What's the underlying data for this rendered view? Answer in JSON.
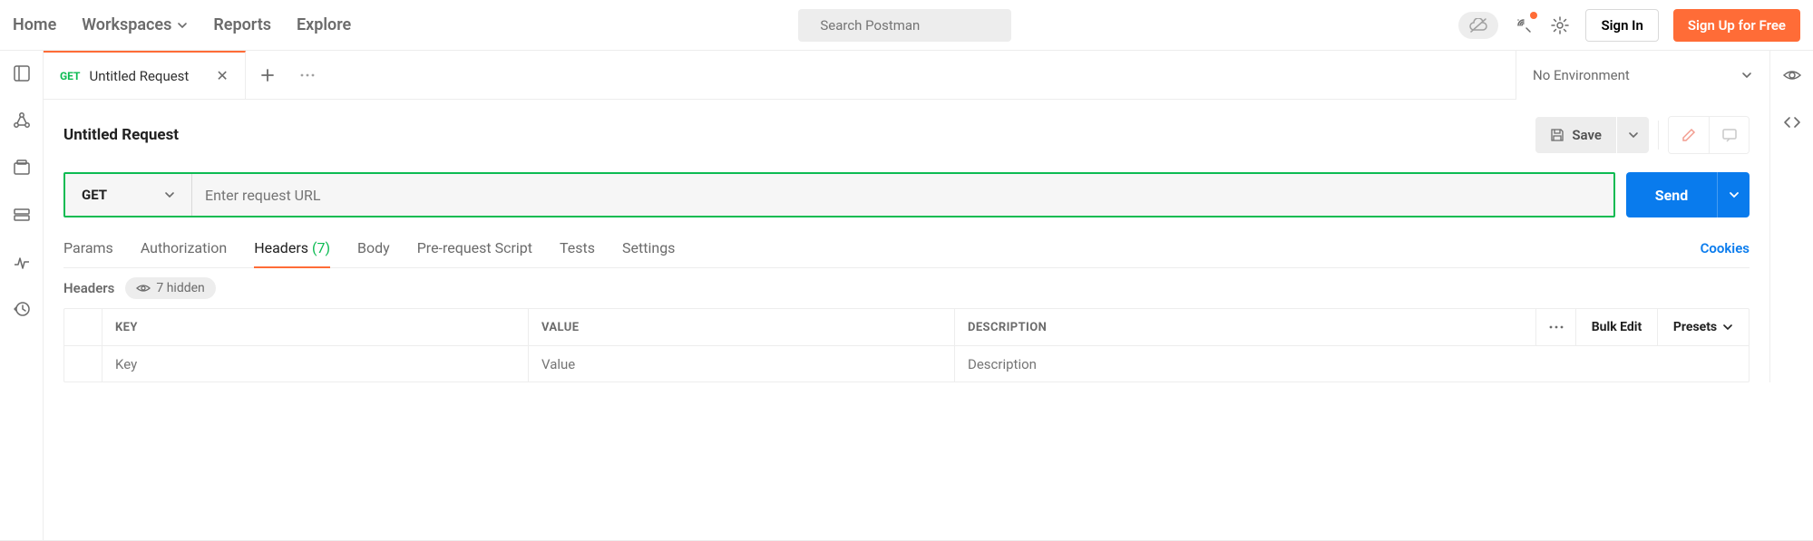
{
  "nav": {
    "home": "Home",
    "workspaces": "Workspaces",
    "reports": "Reports",
    "explore": "Explore"
  },
  "search": {
    "placeholder": "Search Postman"
  },
  "auth": {
    "signin": "Sign In",
    "signup": "Sign Up for Free"
  },
  "tab": {
    "method": "GET",
    "name": "Untitled Request"
  },
  "env": {
    "label": "No Environment"
  },
  "request": {
    "title": "Untitled Request",
    "save_label": "Save",
    "method": "GET",
    "url_placeholder": "Enter request URL",
    "send_label": "Send"
  },
  "subtabs": {
    "params": "Params",
    "authorization": "Authorization",
    "headers": "Headers",
    "headers_count": "(7)",
    "body": "Body",
    "prerequest": "Pre-request Script",
    "tests": "Tests",
    "settings": "Settings"
  },
  "cookies": "Cookies",
  "headers_section": {
    "label": "Headers",
    "hidden_text": "7 hidden"
  },
  "table": {
    "key": "KEY",
    "value": "VALUE",
    "desc": "DESCRIPTION",
    "bulk": "Bulk Edit",
    "presets": "Presets",
    "key_ph": "Key",
    "value_ph": "Value",
    "desc_ph": "Description"
  }
}
